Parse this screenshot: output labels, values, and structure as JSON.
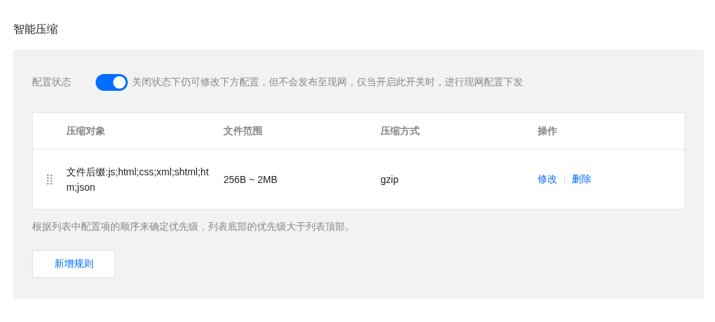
{
  "title": "智能压缩",
  "config": {
    "label": "配置状态",
    "on": true,
    "hint": "关闭状态下仍可修改下方配置，但不会发布至现网，仅当开启此开关时，进行现网配置下发"
  },
  "table": {
    "columns": [
      "压缩对象",
      "文件范围",
      "压缩方式",
      "操作"
    ],
    "rows": [
      {
        "target": "文件后缀:js;html;css;xml;shtml;htm;json",
        "range": "256B ~ 2MB",
        "method": "gzip",
        "actions": [
          "修改",
          "删除"
        ]
      }
    ]
  },
  "note": "根据列表中配置项的顺序来确定优先级，列表底部的优先级大于列表顶部。",
  "add_button": "新增规则"
}
